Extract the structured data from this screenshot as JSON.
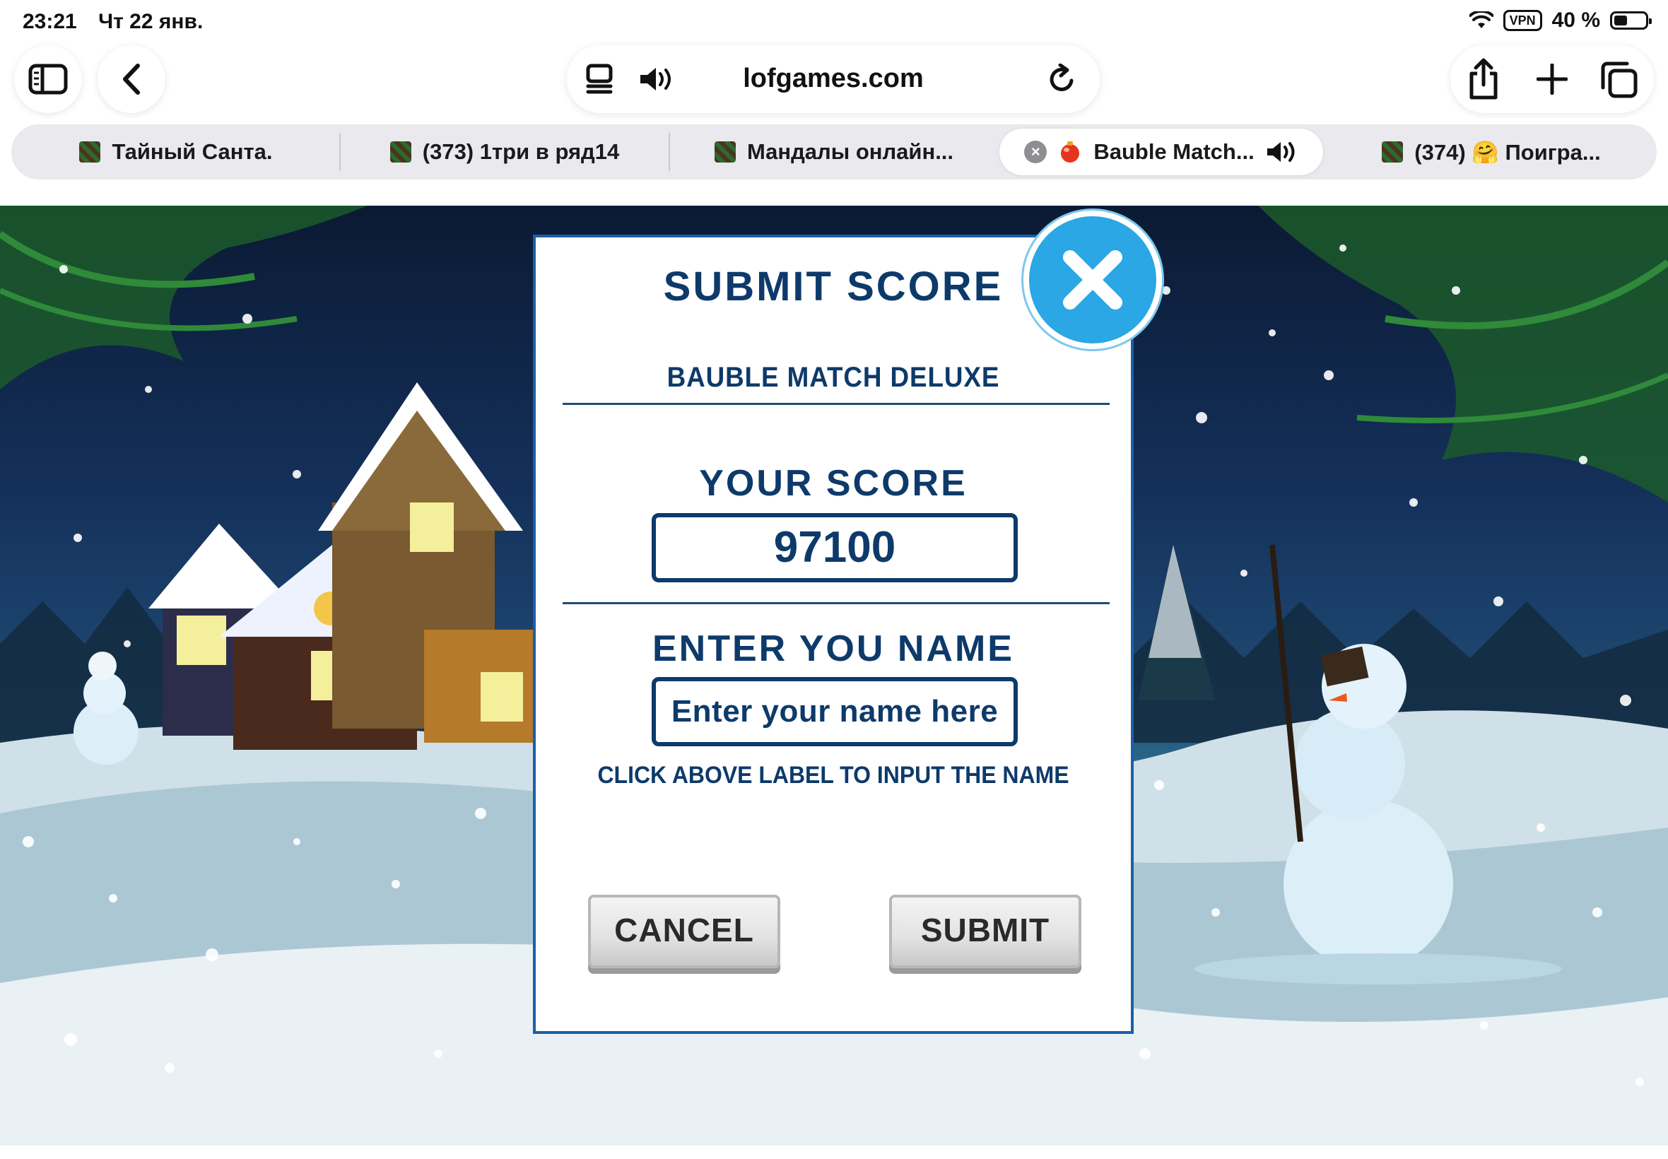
{
  "status_bar": {
    "time": "23:21",
    "date": "Чт 22 янв.",
    "vpn": "VPN",
    "battery": "40 %"
  },
  "toolbar": {
    "url": "lofgames.com",
    "sidebar_icon": "sidebar-icon",
    "back_icon": "chevron-left-icon",
    "reader_icon": "reader-icon",
    "audio_icon": "speaker-icon",
    "reload_icon": "reload-icon",
    "share_icon": "share-icon",
    "new_tab_icon": "plus-icon",
    "tabs_icon": "tabs-overview-icon"
  },
  "tabs": [
    {
      "label": "Тайный Санта.",
      "active": false
    },
    {
      "label": "(373) 1три в ряд14",
      "active": false
    },
    {
      "label": "Мандалы онлайн...",
      "active": false
    },
    {
      "label": "Bauble Match...",
      "active": true
    },
    {
      "label": "(374) 🤗 Поигра...",
      "active": false
    }
  ],
  "dialog": {
    "title": "SUBMIT SCORE",
    "game_name": "BAUBLE MATCH DELUXE",
    "score_label": "YOUR SCORE",
    "score_value": "97100",
    "name_label": "ENTER YOU NAME",
    "name_placeholder": "Enter your name here",
    "hint": "CLICK ABOVE LABEL TO INPUT THE NAME",
    "cancel_label": "CANCEL",
    "submit_label": "SUBMIT",
    "close_icon": "close-icon"
  },
  "colors": {
    "dialog_text": "#0d3a6a",
    "close_button": "#2aa7e4",
    "dialog_border": "#1b5fa8"
  }
}
